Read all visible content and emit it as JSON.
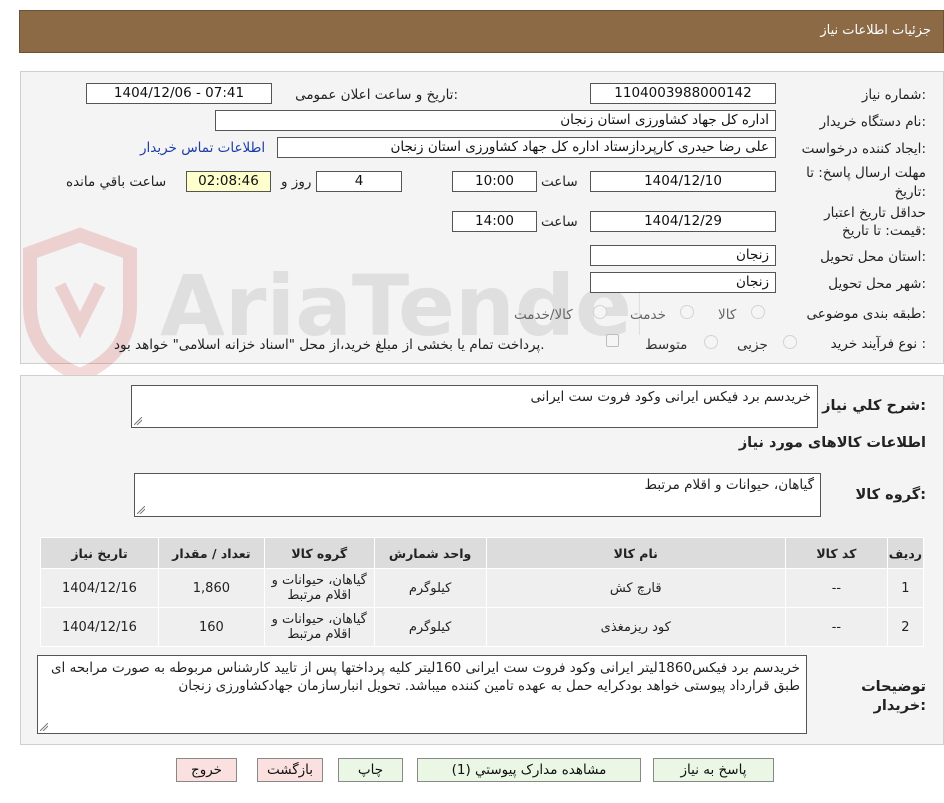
{
  "header": {
    "title": "جزئیات اطلاعات نیاز"
  },
  "watermark": {
    "text": "AriaTender.neT"
  },
  "form": {
    "need_number_label": "شماره نیاز:",
    "need_number": "1104003988000142",
    "announce_label": "تاریخ و ساعت اعلان عمومی:",
    "announce_value": "1404/12/06 - 07:41",
    "buyer_org_label": "نام دستگاه خریدار:",
    "buyer_org": "اداره کل جهاد کشاورزی استان زنجان",
    "creator_label": "ایجاد کننده درخواست:",
    "creator": "علی رضا حیدری کارپردازستاد اداره کل جهاد کشاورزی استان زنجان",
    "contact_link": "اطلاعات تماس خریدار",
    "deadline_label_1": "مهلت ارسال پاسخ: تا",
    "deadline_label_2": "تاریخ:",
    "deadline_date": "1404/12/10",
    "time_label": "ساعت",
    "deadline_time": "10:00",
    "days_value": "4",
    "days_label": "روز و",
    "remaining_time": "02:08:46",
    "remaining_label": "ساعت باقي مانده",
    "validity_label_1": "حداقل تاریخ اعتبار",
    "validity_label_2": "قیمت: تا تاریخ:",
    "validity_date": "1404/12/29",
    "validity_time": "14:00",
    "province_label": "استان محل تحویل:",
    "province": "زنجان",
    "city_label": "شهر محل تحویل:",
    "city": "زنجان",
    "category_label": "طبقه بندی موضوعی:",
    "category_options": [
      "کالا",
      "خدمت",
      "کالا/خدمت"
    ],
    "process_label": "نوع فرآیند خرید :",
    "process_options": [
      "جزیی",
      "متوسط"
    ],
    "payment_note": "پرداخت تمام یا بخشی از مبلغ خرید،از محل \"اسناد خزانه اسلامی\" خواهد بود."
  },
  "summary": {
    "label": "شرح کلي نياز:",
    "value": "خریدسم برد فیکس ایرانی وکود فروت ست ایرانی",
    "goods_info_title": "اطلاعات کالاهای مورد نیاز",
    "group_label": "گروه کالا:",
    "group_value": "گیاهان، حیوانات و اقلام مرتبط"
  },
  "table": {
    "headers": [
      "ردیف",
      "کد کالا",
      "نام کالا",
      "واحد شمارش",
      "گروه کالا",
      "تعداد / مقدار",
      "تاریخ نیاز"
    ],
    "rows": [
      [
        "1",
        "--",
        "قارچ کش",
        "کیلوگرم",
        "گیاهان، حیوانات و اقلام مرتبط",
        "1,860",
        "1404/12/16"
      ],
      [
        "2",
        "--",
        "کود ریزمغذی",
        "کیلوگرم",
        "گیاهان، حیوانات و اقلام مرتبط",
        "160",
        "1404/12/16"
      ]
    ]
  },
  "notes": {
    "label_1": "توضیحات",
    "label_2": "خریدار:",
    "value": "خریدسم برد فیکس1860لیتر ایرانی وکود فروت ست ایرانی 160لیتر کلیه پرداختها  پس از تایید کارشناس مربوطه به صورت مرابحه ای طبق قرارداد پیوستی  خواهد بودکرایه حمل به عهده تامین کننده میباشد. تحویل انبارسازمان جهادکشاورزی زنجان"
  },
  "buttons": {
    "reply": "پاسخ به نیاز",
    "view_docs": "مشاهده مدارک پیوستي (1)",
    "print": "چاپ",
    "back": "بازگشت",
    "exit": "خروج"
  },
  "colors": {
    "header": "#8b6a45",
    "panel": "#f4f4f4",
    "link": "#1a3da8"
  }
}
